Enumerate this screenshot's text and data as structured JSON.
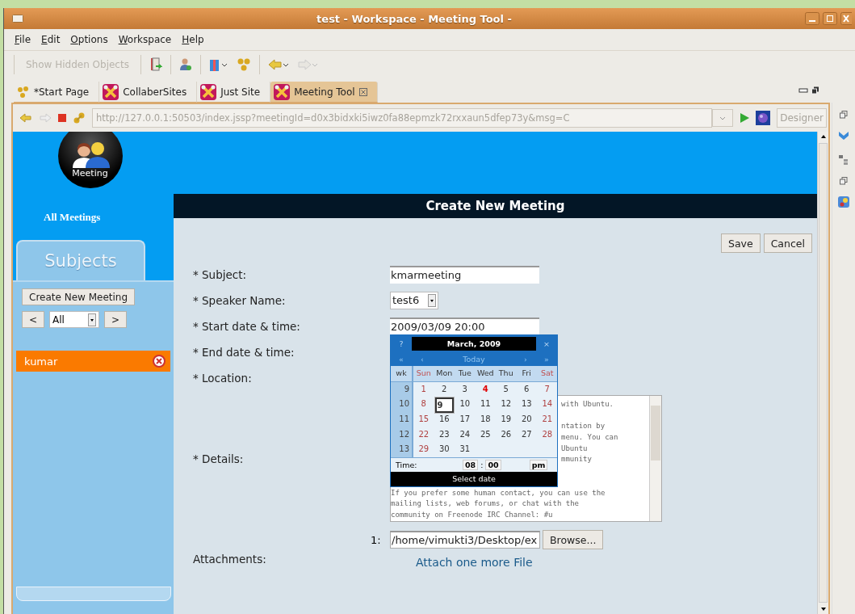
{
  "window": {
    "title": "test - Workspace - Meeting Tool -"
  },
  "menu": [
    "File",
    "Edit",
    "Options",
    "Workspace",
    "Help"
  ],
  "toolbar": {
    "show_hidden": {
      "label": "Show Hidden Objects",
      "disabled": true
    }
  },
  "tabs": [
    {
      "label": "*Start Page",
      "kind": "start",
      "selected": false
    },
    {
      "label": "CollaberSites",
      "kind": "site",
      "selected": false
    },
    {
      "label": "Just Site",
      "kind": "site",
      "selected": false
    },
    {
      "label": "Meeting Tool",
      "kind": "site",
      "selected": true
    }
  ],
  "address": {
    "url": "http://127.0.0.1:50503/index.jssp?meetingId=d0x3bidxki5iwz0fa88epmzk72rxxaun5dfep73y&msg=C",
    "button": "Designer"
  },
  "sidebar": {
    "logo_label": "Meeting",
    "all_meetings": "All Meetings",
    "tab": "Subjects",
    "create_button": "Create New Meeting",
    "prev": "<",
    "filter": "All",
    "next": ">",
    "items": [
      {
        "label": "kumar",
        "selected": true
      }
    ]
  },
  "form": {
    "title": "Create New Meeting",
    "buttons": [
      "Save",
      "Cancel"
    ],
    "fields": [
      {
        "kind": "text",
        "label": "* Subject:",
        "value": "kmarmeeting"
      },
      {
        "kind": "select",
        "label": "* Speaker Name:",
        "value": "test6"
      },
      {
        "kind": "text",
        "label": "* Start date & time:",
        "value": "2009/03/09 20:00"
      },
      {
        "kind": "covered",
        "label": "* End date & time:"
      },
      {
        "kind": "covered",
        "label": "* Location:"
      },
      {
        "kind": "textarea",
        "label": "* Details:",
        "lines": [
          {
            "kind": "partial",
            "text": "with Ubuntu."
          },
          {
            "kind": "blank"
          },
          {
            "kind": "partial",
            "text": "ntation by"
          },
          {
            "kind": "partial",
            "text": "menu. You can"
          },
          {
            "kind": "partial",
            "text": "Ubuntu"
          },
          {
            "kind": "partial",
            "text": "mmunity"
          },
          {
            "kind": "blank"
          },
          {
            "kind": "blank"
          },
          {
            "kind": "full",
            "text": "If you prefer some human contact, you can use the"
          },
          {
            "kind": "full",
            "text": "mailing lists, web forums, or chat with the"
          },
          {
            "kind": "full",
            "text": "community on Freenode IRC Channel: #u"
          }
        ]
      }
    ],
    "attachments": {
      "label": "Attachments:",
      "index": "1:",
      "path": "/home/vimukti3/Desktop/ex",
      "browse": "Browse...",
      "more": "Attach one more File"
    }
  },
  "calendar": {
    "help": "?",
    "title": "March, 2009",
    "close": "×",
    "nav": [
      "«",
      "‹",
      "Today",
      "›",
      "»"
    ],
    "wk": "wk",
    "days": [
      "Sun",
      "Mon",
      "Tue",
      "Wed",
      "Thu",
      "Fri",
      "Sat"
    ],
    "weeks": [
      {
        "wk": "9",
        "days": [
          {
            "d": "1",
            "today": false,
            "selected": false
          },
          {
            "d": "2",
            "today": false,
            "selected": false
          },
          {
            "d": "3",
            "today": false,
            "selected": false
          },
          {
            "d": "4",
            "today": true,
            "selected": false
          },
          {
            "d": "5",
            "today": false,
            "selected": false
          },
          {
            "d": "6",
            "today": false,
            "selected": false
          },
          {
            "d": "7",
            "today": false,
            "selected": false
          }
        ]
      },
      {
        "wk": "10",
        "days": [
          {
            "d": "8",
            "today": false,
            "selected": false
          },
          {
            "d": "9",
            "today": false,
            "selected": true
          },
          {
            "d": "10",
            "today": false,
            "selected": false
          },
          {
            "d": "11",
            "today": false,
            "selected": false
          },
          {
            "d": "12",
            "today": false,
            "selected": false
          },
          {
            "d": "13",
            "today": false,
            "selected": false
          },
          {
            "d": "14",
            "today": false,
            "selected": false
          }
        ]
      },
      {
        "wk": "11",
        "days": [
          {
            "d": "15",
            "today": false,
            "selected": false
          },
          {
            "d": "16",
            "today": false,
            "selected": false
          },
          {
            "d": "17",
            "today": false,
            "selected": false
          },
          {
            "d": "18",
            "today": false,
            "selected": false
          },
          {
            "d": "19",
            "today": false,
            "selected": false
          },
          {
            "d": "20",
            "today": false,
            "selected": false
          },
          {
            "d": "21",
            "today": false,
            "selected": false
          }
        ]
      },
      {
        "wk": "12",
        "days": [
          {
            "d": "22",
            "today": false,
            "selected": false
          },
          {
            "d": "23",
            "today": false,
            "selected": false
          },
          {
            "d": "24",
            "today": false,
            "selected": false
          },
          {
            "d": "25",
            "today": false,
            "selected": false
          },
          {
            "d": "26",
            "today": false,
            "selected": false
          },
          {
            "d": "27",
            "today": false,
            "selected": false
          },
          {
            "d": "28",
            "today": false,
            "selected": false
          }
        ]
      },
      {
        "wk": "13",
        "days": [
          {
            "d": "29",
            "today": false,
            "selected": false
          },
          {
            "d": "30",
            "today": false,
            "selected": false
          },
          {
            "d": "31",
            "today": false,
            "selected": false
          }
        ]
      }
    ],
    "time": {
      "label": "Time:",
      "hour": "08",
      "sep": ":",
      "minute": "00",
      "ampm": "pm"
    },
    "footer": "Select date"
  }
}
